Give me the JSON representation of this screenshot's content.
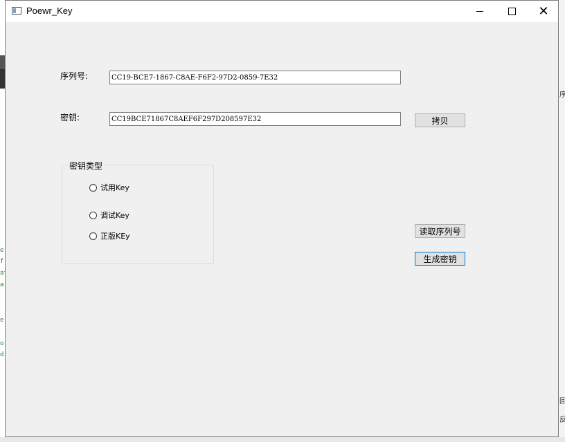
{
  "window": {
    "title": "Poewr_Key",
    "controls": {
      "minimize_icon": "minimize-icon",
      "maximize_icon": "maximize-icon",
      "close_icon": "close-icon",
      "close_glyph": "✕"
    }
  },
  "form": {
    "serial_label": "序列号:",
    "serial_value": "CC19-BCE7-1867-C8AE-F6F2-97D2-0859-7E32",
    "key_label": "密钥:",
    "key_value": "CC19BCE71867C8AEF6F297D208597E32",
    "copy_button": "拷贝",
    "read_serial_button": "读取序列号",
    "generate_key_button": "生成密钥"
  },
  "key_type": {
    "title": "密钥类型",
    "options": [
      {
        "label": "试用Key",
        "selected": false
      },
      {
        "label": "调试Key",
        "selected": false
      },
      {
        "label": "正版KEy",
        "selected": false
      }
    ]
  },
  "background": {
    "right_fragments": [
      "序",
      "回",
      "反"
    ],
    "left_code": [
      "e",
      "f",
      "at",
      "a",
      "e",
      "o",
      "d"
    ]
  }
}
